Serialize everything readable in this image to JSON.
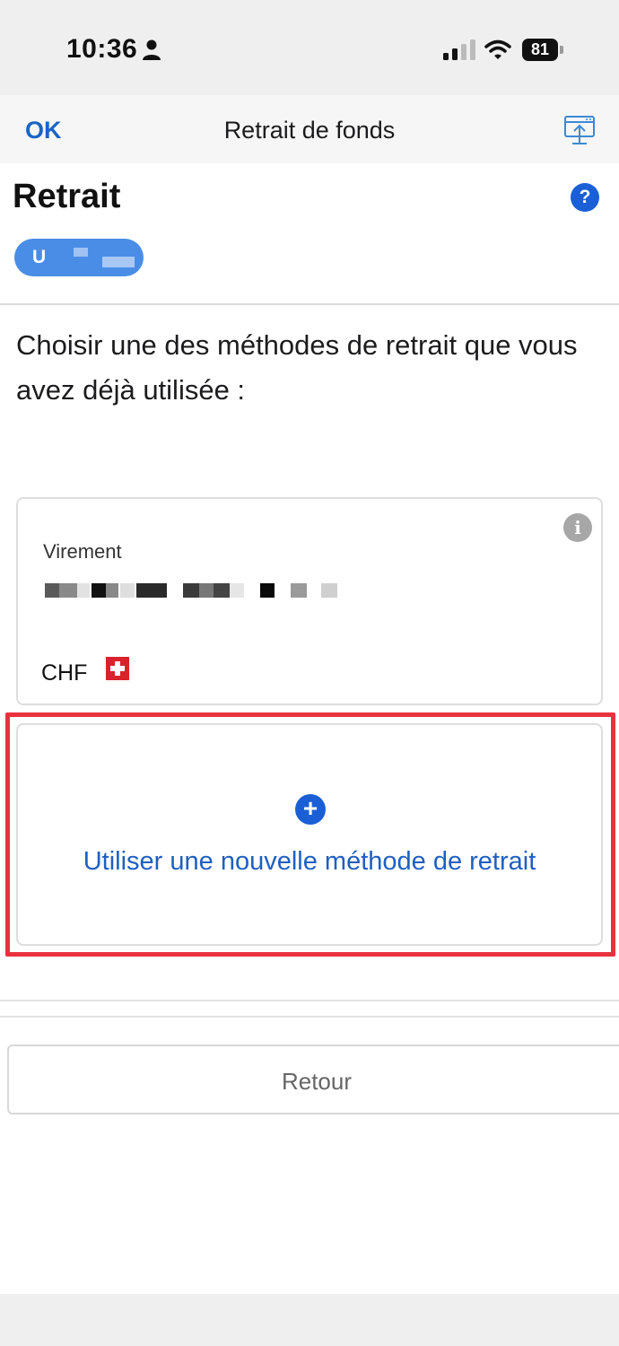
{
  "status_bar": {
    "time": "10:36",
    "battery": "81"
  },
  "nav": {
    "ok_label": "OK",
    "title": "Retrait de fonds"
  },
  "header": {
    "title": "Retrait",
    "help_glyph": "?",
    "account_initial": "U"
  },
  "instruction": "Choisir une des méthodes de retrait que vous avez déjà utilisée :",
  "methods": [
    {
      "type": "Virement",
      "account_number": "masked",
      "currency": "CHF",
      "flag": "swiss-flag-icon"
    }
  ],
  "new_method": {
    "label": "Utiliser une nouvelle méthode de retrait",
    "icon": "plus-circle-icon"
  },
  "footer": {
    "back_label": "Retour"
  },
  "colors": {
    "accent": "#1a5fd6",
    "link": "#1f5fc2",
    "highlight": "#e8333f",
    "pill": "#4a8de6"
  }
}
